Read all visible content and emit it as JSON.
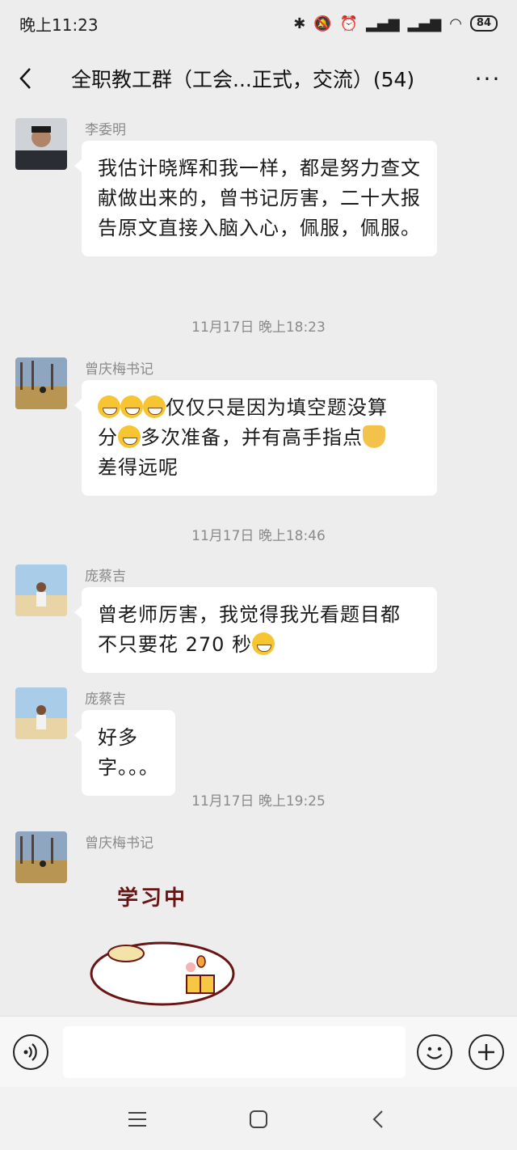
{
  "status": {
    "time": "晚上11:23",
    "battery": "84"
  },
  "header": {
    "title": "全职教工群（工会...正式，交流）(54)",
    "more": "···"
  },
  "messages": [
    {
      "sender": "李委明",
      "text": "我估计晓辉和我一样，都是努力查文献做出来的，曾书记厉害，二十大报告原文直接入脑入心，佩服，佩服。"
    },
    {
      "time": "11月17日 晚上18:23"
    },
    {
      "sender": "曾庆梅书记",
      "part1": "仅仅只是因为填空题没算",
      "part2": "分",
      "part3": "多次准备，并有高手指点",
      "part4": "差得远呢"
    },
    {
      "time": "11月17日 晚上18:46"
    },
    {
      "sender": "庞蔡吉",
      "part1": "曾老师厉害，我觉得我光看题目都",
      "part2": "不只要花 270 秒"
    },
    {
      "sender": "庞蔡吉",
      "text": "好多字。。。"
    },
    {
      "time": "11月17日 晚上19:25"
    },
    {
      "sender": "曾庆梅书记",
      "sticker_text": "学习中"
    }
  ],
  "colors": {
    "background": "#ededed",
    "bubble": "#ffffff",
    "meta_text": "#8a8a8a"
  }
}
